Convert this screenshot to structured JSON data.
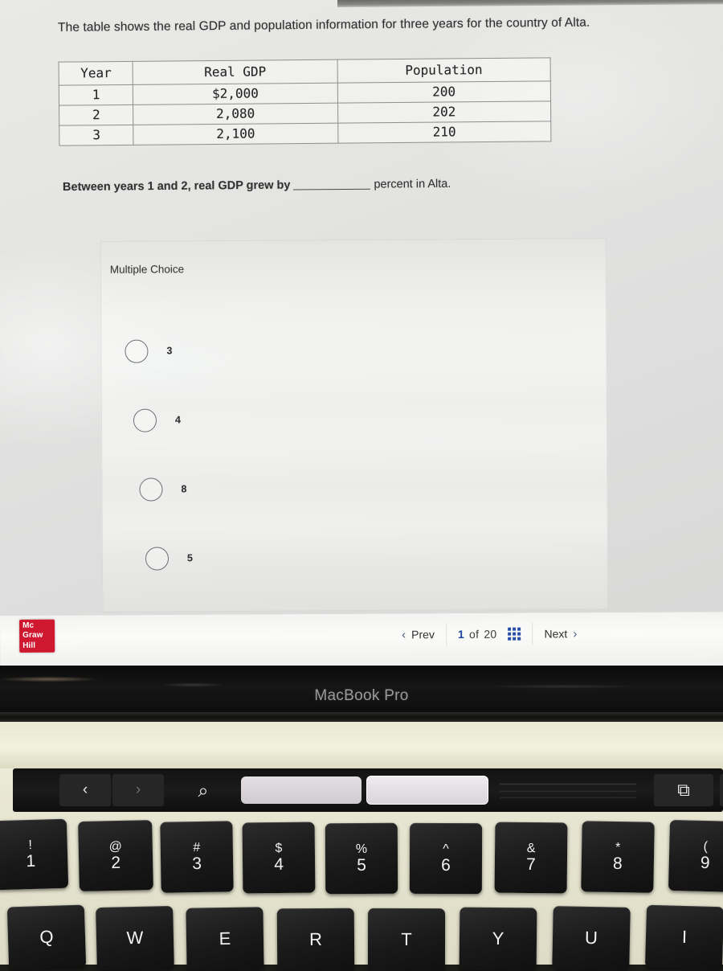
{
  "question": {
    "stem": "The table shows the real GDP and population information for three years for the country of Alta.",
    "prompt_before": "Between years 1 and 2, real GDP grew by",
    "prompt_after": "percent in Alta.",
    "type_label": "Multiple Choice"
  },
  "table": {
    "headers": [
      "Year",
      "Real GDP",
      "Population"
    ],
    "rows": [
      [
        "1",
        "$2,000",
        "200"
      ],
      [
        "2",
        "2,080",
        "202"
      ],
      [
        "3",
        "2,100",
        "210"
      ]
    ]
  },
  "options": [
    {
      "label": "3",
      "selected": false
    },
    {
      "label": "4",
      "selected": false
    },
    {
      "label": "8",
      "selected": false
    },
    {
      "label": "5",
      "selected": false
    }
  ],
  "footer": {
    "logo_line1": "Mc",
    "logo_line2": "Graw",
    "logo_line3": "Hill",
    "logo_color": "#cf1830",
    "prev_label": "Prev",
    "next_label": "Next",
    "prev_chevron": "‹",
    "next_chevron": "›",
    "counter_current": "1",
    "counter_middle": "of",
    "counter_total": "20",
    "accent_color": "#1f4aa0"
  },
  "hardware": {
    "brand_text": "MacBook Pro",
    "touchbar": {
      "back_glyph": "‹",
      "forward_glyph": "›",
      "search_glyph": "⌕",
      "newtab_glyph": "⧉"
    },
    "keyboard": {
      "number_row": [
        {
          "upper": "!",
          "lower": "1"
        },
        {
          "upper": "@",
          "lower": "2"
        },
        {
          "upper": "#",
          "lower": "3"
        },
        {
          "upper": "$",
          "lower": "4"
        },
        {
          "upper": "%",
          "lower": "5"
        },
        {
          "upper": "^",
          "lower": "6"
        },
        {
          "upper": "&",
          "lower": "7"
        },
        {
          "upper": "*",
          "lower": "8"
        },
        {
          "upper": "(",
          "lower": "9"
        }
      ],
      "letter_row": [
        "Q",
        "W",
        "E",
        "R",
        "T",
        "Y",
        "U",
        "I"
      ]
    }
  }
}
